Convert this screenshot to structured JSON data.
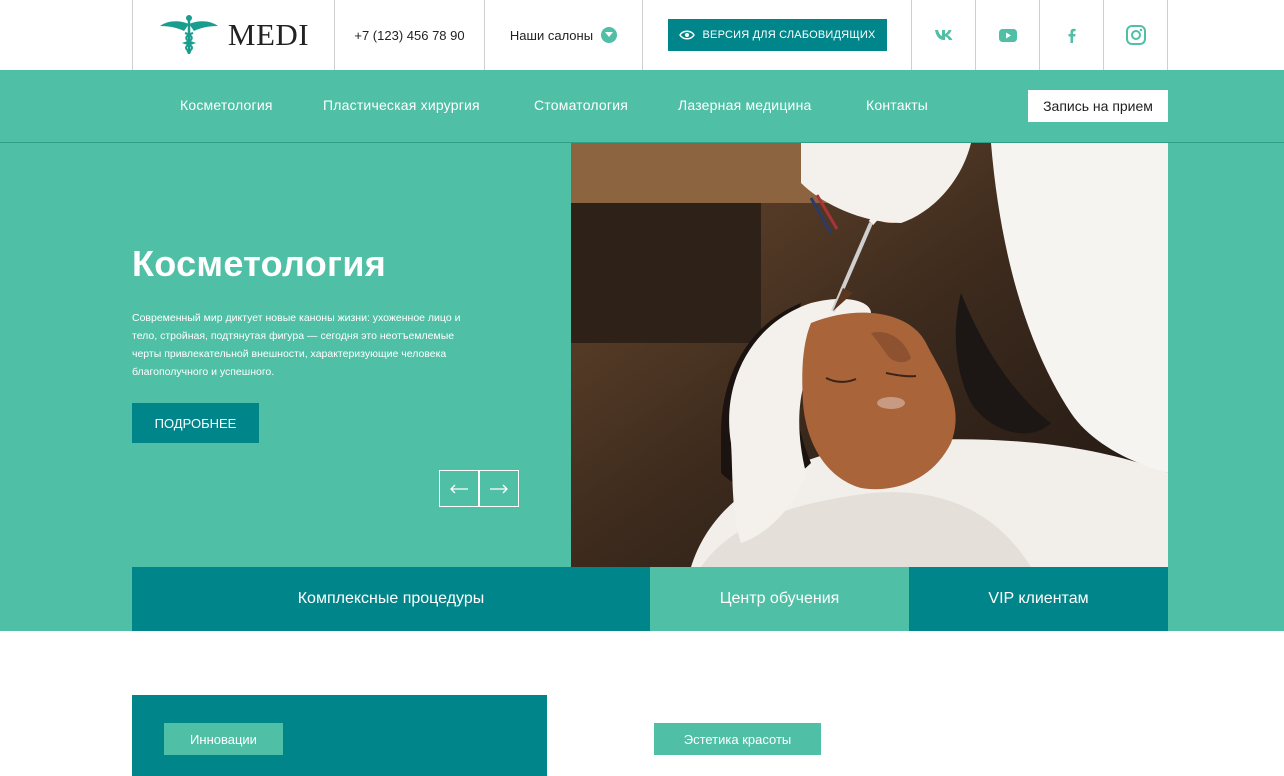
{
  "header": {
    "logo_text": "MEDI",
    "phone": "+7 (123) 456 78 90",
    "salons_label": "Наши салоны",
    "accessibility_label": "ВЕРСИЯ ДЛЯ СЛАБОВИДЯЩИХ",
    "social": [
      "vk-icon",
      "youtube-icon",
      "facebook-icon",
      "instagram-icon"
    ]
  },
  "nav": {
    "items": [
      {
        "label": "Косметология"
      },
      {
        "label": "Пластическая хирургия"
      },
      {
        "label": "Стоматология"
      },
      {
        "label": "Лазерная медицина"
      },
      {
        "label": "Контакты"
      }
    ],
    "book_label": "Запись на прием"
  },
  "hero": {
    "title": "Косметология",
    "text": "Современный мир диктует новые каноны жизни: ухоженное лицо и тело, стройная, подтянутая фигура — сегодня это неотъемлемые черты привлекательной внешности, характеризующие человека благополучного и успешного.",
    "more_label": "ПОДРОБНЕЕ",
    "prev_arrow": "←",
    "next_arrow": "→"
  },
  "tabs": [
    {
      "label": "Комплексные процедуры"
    },
    {
      "label": "Центр обучения"
    },
    {
      "label": "VIP клиентам"
    }
  ],
  "bottom": {
    "tag_1": "Инновации",
    "tag_2": "Эстетика красоты"
  },
  "colors": {
    "accent": "#4fbfa5",
    "dark_teal": "#00868a"
  }
}
